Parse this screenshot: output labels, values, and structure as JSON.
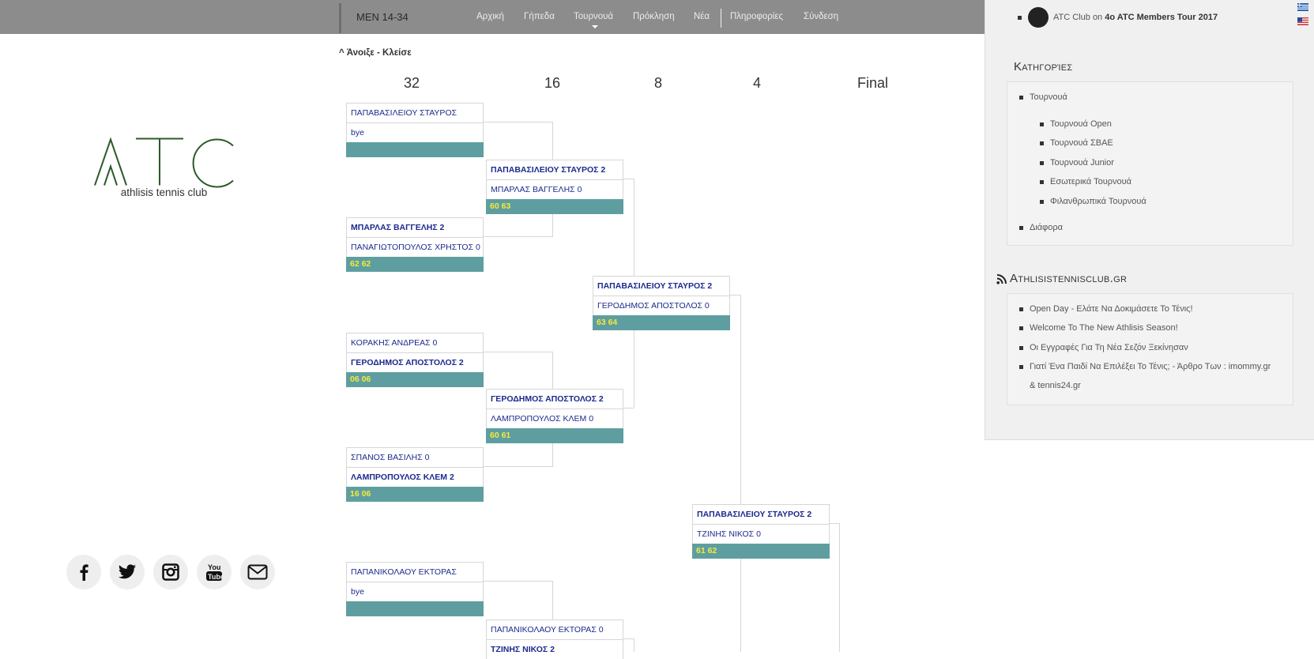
{
  "header": {
    "brand": "MEN 14-34",
    "nav": [
      "Αρχική",
      "Γήπεδα",
      "Τουρνουά",
      "Πρόκληση",
      "Νέα",
      "Πληροφορίες",
      "Σύνδεση"
    ]
  },
  "logo": {
    "text": "ATC",
    "subtitle": "athlisis tennis club"
  },
  "social": [
    "facebook-icon",
    "twitter-icon",
    "instagram-icon",
    "youtube-icon",
    "mail-icon"
  ],
  "toggle_label": "Άνοιξε - Κλείσε",
  "rounds": [
    "32",
    "16",
    "8",
    "4",
    "Final"
  ],
  "bracket": {
    "r32": [
      {
        "p1": "ΠΑΠΑΒΑΣΙΛΕΙΟΥ ΣΤΑΥΡΟΣ",
        "p2": "bye",
        "score": ""
      },
      {
        "p1": "ΜΠΑΡΛΑΣ ΒΑΓΓΕΛΗΣ 2",
        "p2": "ΠΑΝΑΓΙΩΤΟΠΟΥΛΟΣ ΧΡΗΣΤΟΣ 0",
        "score": "62 62"
      },
      {
        "p1": "ΚΟΡΑΚΗΣ ΑΝΔΡΕΑΣ 0",
        "p2": "ΓΕΡΟΔΗΜΟΣ ΑΠΟΣΤΟΛΟΣ 2",
        "score": "06 06"
      },
      {
        "p1": "ΣΠΑΝΟΣ ΒΑΣΙΛΗΣ 0",
        "p2": "ΛΑΜΠΡΟΠΟΥΛΟΣ ΚΛΕΜ 2",
        "score": "16 06"
      },
      {
        "p1": "ΠΑΠΑΝΙΚΟΛΑΟΥ ΕΚΤΟΡΑΣ",
        "p2": "bye",
        "score": ""
      }
    ],
    "r16": [
      {
        "p1": "ΠΑΠΑΒΑΣΙΛΕΙΟΥ ΣΤΑΥΡΟΣ 2",
        "p2": "ΜΠΑΡΛΑΣ ΒΑΓΓΕΛΗΣ 0",
        "score": "60 63"
      },
      {
        "p1": "ΓΕΡΟΔΗΜΟΣ ΑΠΟΣΤΟΛΟΣ 2",
        "p2": "ΛΑΜΠΡΟΠΟΥΛΟΣ ΚΛΕΜ 0",
        "score": "60 61"
      },
      {
        "p1": "ΠΑΠΑΝΙΚΟΛΑΟΥ ΕΚΤΟΡΑΣ 0",
        "p2": "ΤΖΙΝΗΣ ΝΙΚΟΣ 2",
        "score": ""
      }
    ],
    "r8": [
      {
        "p1": "ΠΑΠΑΒΑΣΙΛΕΙΟΥ ΣΤΑΥΡΟΣ 2",
        "p2": "ΓΕΡΟΔΗΜΟΣ ΑΠΟΣΤΟΛΟΣ 0",
        "score": "63 64"
      }
    ],
    "r4": [
      {
        "p1": "ΠΑΠΑΒΑΣΙΛΕΙΟΥ ΣΤΑΥΡΟΣ 2",
        "p2": "ΤΖΙΝΗΣ ΝΙΚΟΣ 0",
        "score": "61 62"
      }
    ]
  },
  "sidebar": {
    "recent_comment": {
      "author": "ATC Club",
      "on": "on",
      "post": "4o ATC Members Tour 2017"
    },
    "categories_title": "Κατηγορίες",
    "categories": {
      "main": "Τουρνουά",
      "sub": [
        "Τουρνουά Open",
        "Τουρνουά ΣΒΑΕ",
        "Τουρνουά Junior",
        "Εσωτερικά Τουρνουά",
        "Φιλανθρωπικά Τουρνουά"
      ],
      "other": "Διάφορα"
    },
    "feed_title": "Athlisistennisclub.gr",
    "feed": [
      "Open Day - Ελάτε Να Δοκιμάσετε Το Τένις!",
      "Welcome To The New Athlisis Season!",
      "Οι Εγγραφές Για Τη Νέα Σεζόν Ξεκίνησαν",
      "Γιατί Ένα Παιδί Να Επιλέξει Το Τένις; - Άρθρο Των : imommy.gr",
      "& tennis24.gr"
    ]
  }
}
